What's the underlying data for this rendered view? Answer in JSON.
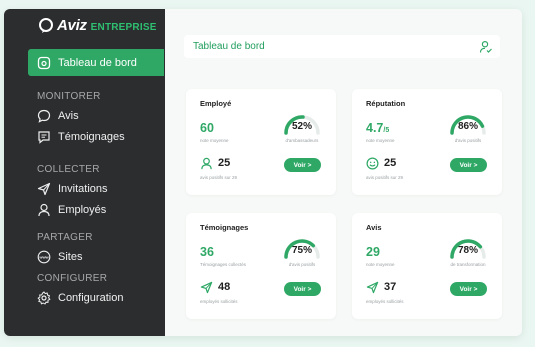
{
  "brand": {
    "name": "Aviz",
    "suffix": "ENTREPRISE"
  },
  "sidebar": {
    "active_label": "Tableau de bord",
    "sections": {
      "monitorer": "MONITORER",
      "collecter": "COLLECTER",
      "partager": "PARTAGER",
      "configurer": "CONFIGURER"
    },
    "items": {
      "avis": "Avis",
      "temoignages": "Témoignages",
      "invitations": "Invitations",
      "employes": "Employés",
      "sites": "Sites",
      "configuration": "Configuration"
    }
  },
  "header": {
    "title": "Tableau de bord"
  },
  "cards": {
    "employe": {
      "title": "Employé",
      "stat_value": "60",
      "stat_unit": "",
      "stat_label": "note moyenne",
      "gauge_value": "52%",
      "gauge_percent": 52,
      "gauge_label": "d'ambassadeurs",
      "second_value": "25",
      "second_label": "avis positifs sur 29",
      "button": "Voir >"
    },
    "reputation": {
      "title": "Réputation",
      "stat_value": "4.7",
      "stat_unit": "/5",
      "stat_label": "note moyenne",
      "gauge_value": "86%",
      "gauge_percent": 86,
      "gauge_label": "d'avis positifs",
      "second_value": "25",
      "second_label": "avis positifs sur 29",
      "button": "Voir >"
    },
    "temoignages": {
      "title": "Témoignages",
      "stat_value": "36",
      "stat_unit": "",
      "stat_label": "Témoignages collectés",
      "gauge_value": "75%",
      "gauge_percent": 75,
      "gauge_label": "d'avis positifs",
      "second_value": "48",
      "second_label": "employés sollicités",
      "button": "Voir >"
    },
    "avis": {
      "title": "Avis",
      "stat_value": "29",
      "stat_unit": "",
      "stat_label": "note moyenne",
      "gauge_value": "78%",
      "gauge_percent": 78,
      "gauge_label": "de transformation",
      "second_value": "37",
      "second_label": "employés sollicités",
      "button": "Voir >"
    }
  },
  "colors": {
    "accent": "#2fa866",
    "sidebar": "#2b2d2f",
    "background": "#e9f6f1"
  }
}
